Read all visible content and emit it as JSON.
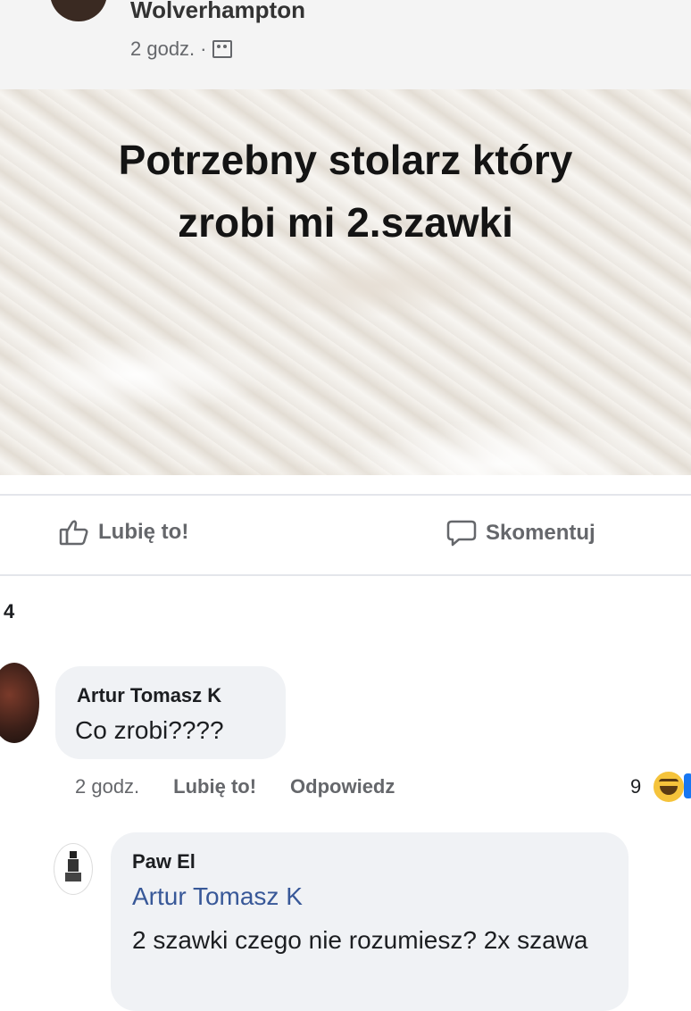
{
  "post": {
    "group_name": "Wolverhampton",
    "time": "2 godz.",
    "separator": "·",
    "audience_icon": "group-icon",
    "text_line1": "Potrzebny stolarz który",
    "text_line2": "zrobi mi 2.szawki"
  },
  "actions": {
    "like_label": "Lubię to!",
    "comment_label": "Skomentuj",
    "like_icon": "thumbs-up-icon",
    "comment_icon": "comment-bubble-icon"
  },
  "count": "4",
  "comments": [
    {
      "author": "Artur Tomasz K",
      "text": "Co zrobi????",
      "time": "2 godz.",
      "like_label": "Lubię to!",
      "reply_label": "Odpowiedz",
      "reaction_count": "9",
      "reaction_icon": "haha-icon"
    },
    {
      "author": "Paw El",
      "mention": "Artur Tomasz K",
      "text": "2 szawki czego nie rozumiesz? 2x szawa"
    }
  ],
  "colors": {
    "mention": "#385898",
    "secondary_text": "#65676b",
    "bubble_bg": "#f0f2f5"
  }
}
